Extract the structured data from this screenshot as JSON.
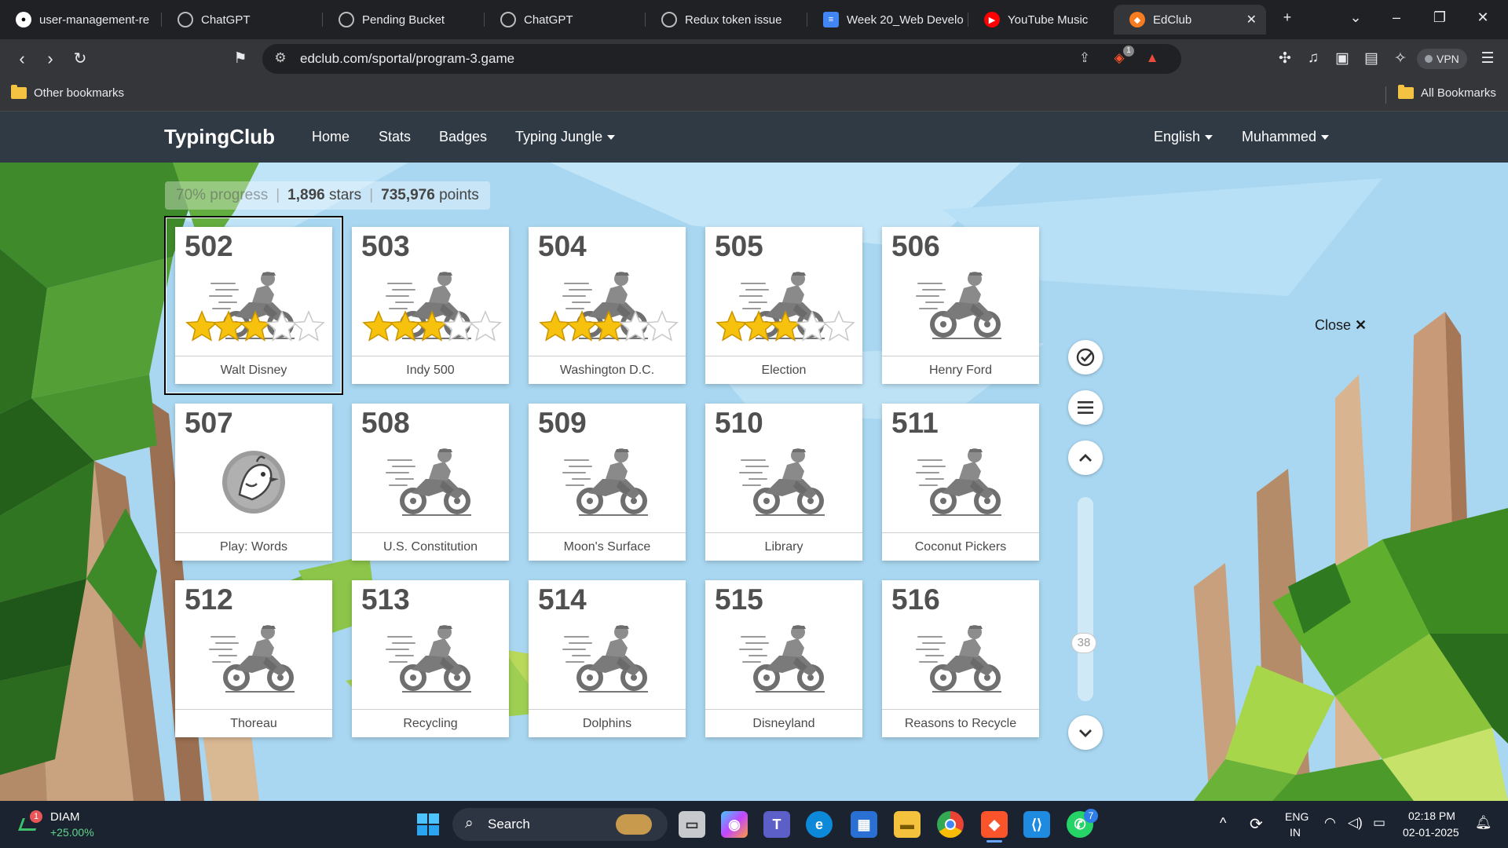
{
  "browser": {
    "tabs": [
      {
        "title": "user-management-re",
        "icon": "github-icon",
        "color": "#ffffff"
      },
      {
        "title": "ChatGPT",
        "icon": "chatgpt-icon",
        "color": "#aaaaaa"
      },
      {
        "title": "Pending Bucket",
        "icon": "globe-icon",
        "color": "#aaaaaa"
      },
      {
        "title": "ChatGPT",
        "icon": "chatgpt-icon",
        "color": "#aaaaaa"
      },
      {
        "title": "Redux token issue",
        "icon": "chatgpt-icon",
        "color": "#aaaaaa"
      },
      {
        "title": "Week 20_Web Develo",
        "icon": "google-docs-icon",
        "color": "#4285f4"
      },
      {
        "title": "YouTube Music",
        "icon": "youtube-music-icon",
        "color": "#ff0000"
      },
      {
        "title": "EdClub",
        "icon": "edclub-icon",
        "color": "#f57c20"
      }
    ],
    "url": "edclub.com/sportal/program-3.game",
    "bookmarks": {
      "other": "Other bookmarks",
      "all": "All Bookmarks"
    },
    "vpn_label": "VPN",
    "brave_badge": "1"
  },
  "site": {
    "brand": "TypingClub",
    "nav": {
      "home": "Home",
      "stats": "Stats",
      "badges": "Badges",
      "jungle": "Typing Jungle"
    },
    "language": "English",
    "user": "Muhammed"
  },
  "progress": {
    "percent": "70% progress",
    "stars_num": "1,896",
    "stars_word": "stars",
    "points_num": "735,976",
    "points_word": "points"
  },
  "lessons": [
    {
      "num": "502",
      "title": "Walt Disney",
      "stars": 3,
      "type": "motorbike",
      "selected": true
    },
    {
      "num": "503",
      "title": "Indy 500",
      "stars": 3,
      "type": "motorbike"
    },
    {
      "num": "504",
      "title": "Washington D.C.",
      "stars": 3,
      "type": "motorbike"
    },
    {
      "num": "505",
      "title": "Election",
      "stars": 3,
      "type": "motorbike"
    },
    {
      "num": "506",
      "title": "Henry Ford",
      "stars": 0,
      "type": "motorbike"
    },
    {
      "num": "507",
      "title": "Play: Words",
      "stars": 0,
      "type": "game"
    },
    {
      "num": "508",
      "title": "U.S. Constitution",
      "stars": 0,
      "type": "motorbike"
    },
    {
      "num": "509",
      "title": "Moon's Surface",
      "stars": 0,
      "type": "motorbike"
    },
    {
      "num": "510",
      "title": "Library",
      "stars": 0,
      "type": "motorbike"
    },
    {
      "num": "511",
      "title": "Coconut Pickers",
      "stars": 0,
      "type": "motorbike"
    },
    {
      "num": "512",
      "title": "Thoreau",
      "stars": 0,
      "type": "motorbike"
    },
    {
      "num": "513",
      "title": "Recycling",
      "stars": 0,
      "type": "motorbike"
    },
    {
      "num": "514",
      "title": "Dolphins",
      "stars": 0,
      "type": "motorbike"
    },
    {
      "num": "515",
      "title": "Disneyland",
      "stars": 0,
      "type": "motorbike"
    },
    {
      "num": "516",
      "title": "Reasons to Recycle",
      "stars": 0,
      "type": "motorbike"
    }
  ],
  "stars_total": 5,
  "scroll_page": "38",
  "close_label": "Close",
  "taskbar": {
    "stock_name": "DIAM",
    "stock_change": "+25.00%",
    "stock_badge": "1",
    "search_placeholder": "Search",
    "lang_line1": "ENG",
    "lang_line2": "IN",
    "time": "02:18 PM",
    "date": "02-01-2025",
    "whatsapp_badge": "7"
  }
}
